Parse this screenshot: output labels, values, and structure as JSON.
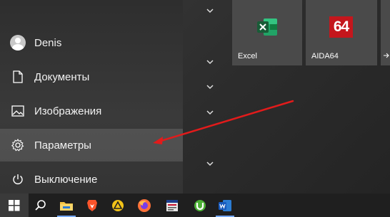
{
  "menu": {
    "user_name": "Denis",
    "items": [
      {
        "label": "Документы",
        "icon": "document-icon"
      },
      {
        "label": "Изображения",
        "icon": "image-icon"
      },
      {
        "label": "Параметры",
        "icon": "gear-icon"
      },
      {
        "label": "Выключение",
        "icon": "power-icon"
      }
    ],
    "selected": "Параметры"
  },
  "tiles": [
    {
      "label": "Excel",
      "icon": "excel-icon",
      "color": "#1d6f42"
    },
    {
      "label": "AIDA64",
      "icon": "aida64-icon",
      "badge": "64",
      "color": "#c4161c"
    }
  ],
  "taskbar": {
    "items": [
      "windows-start-icon",
      "search-icon",
      "file-explorer-icon",
      "brave-icon",
      "angle-icon",
      "firefox-icon",
      "news-icon",
      "utorrent-icon",
      "word-icon"
    ]
  },
  "annotation": {
    "color": "#e21b1b",
    "points_to": "Параметры"
  }
}
